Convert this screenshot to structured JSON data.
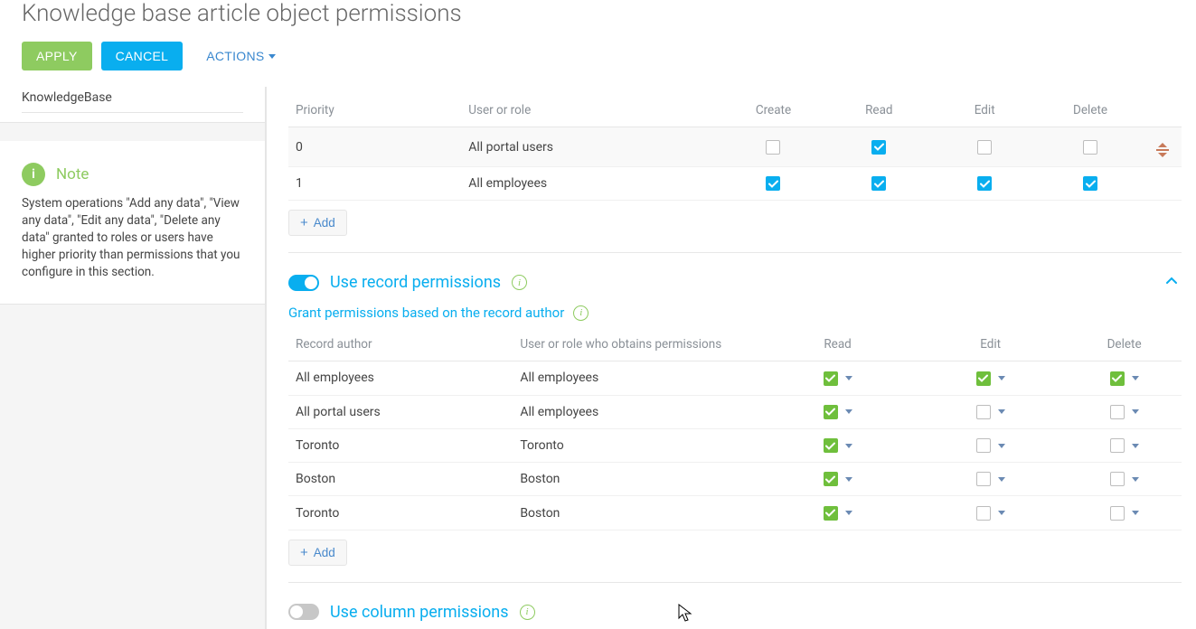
{
  "page": {
    "title": "Knowledge base article object permissions"
  },
  "actions": {
    "apply": "Apply",
    "cancel": "Cancel",
    "actions": "Actions"
  },
  "sidebar": {
    "object_name": "KnowledgeBase",
    "note_label": "Note",
    "note_body": "System operations \"Add any data\", \"View any data\", \"Edit any data\", \"Delete any data\" granted to roles or users have higher priority than permissions that you configure in this section."
  },
  "object_table": {
    "headers": {
      "priority": "Priority",
      "user_or_role": "User or role",
      "create": "Create",
      "read": "Read",
      "edit": "Edit",
      "delete": "Delete"
    },
    "rows": [
      {
        "priority": "0",
        "user_or_role": "All portal users",
        "create": false,
        "read": true,
        "edit": false,
        "delete": false,
        "active": true
      },
      {
        "priority": "1",
        "user_or_role": "All employees",
        "create": true,
        "read": true,
        "edit": true,
        "delete": true,
        "active": false
      }
    ],
    "add": "Add"
  },
  "record_section": {
    "enabled": true,
    "title": "Use record permissions",
    "subtitle": "Grant permissions based on the record author",
    "headers": {
      "author": "Record author",
      "obtains": "User or role who obtains permissions",
      "read": "Read",
      "edit": "Edit",
      "delete": "Delete"
    },
    "rows": [
      {
        "author": "All employees",
        "obtains": "All employees",
        "read": true,
        "edit": true,
        "delete": true
      },
      {
        "author": "All portal users",
        "obtains": "All employees",
        "read": true,
        "edit": false,
        "delete": false
      },
      {
        "author": "Toronto",
        "obtains": "Toronto",
        "read": true,
        "edit": false,
        "delete": false
      },
      {
        "author": "Boston",
        "obtains": "Boston",
        "read": true,
        "edit": false,
        "delete": false
      },
      {
        "author": "Toronto",
        "obtains": "Boston",
        "read": true,
        "edit": false,
        "delete": false
      }
    ],
    "add": "Add"
  },
  "column_section": {
    "enabled": false,
    "title": "Use column permissions"
  }
}
